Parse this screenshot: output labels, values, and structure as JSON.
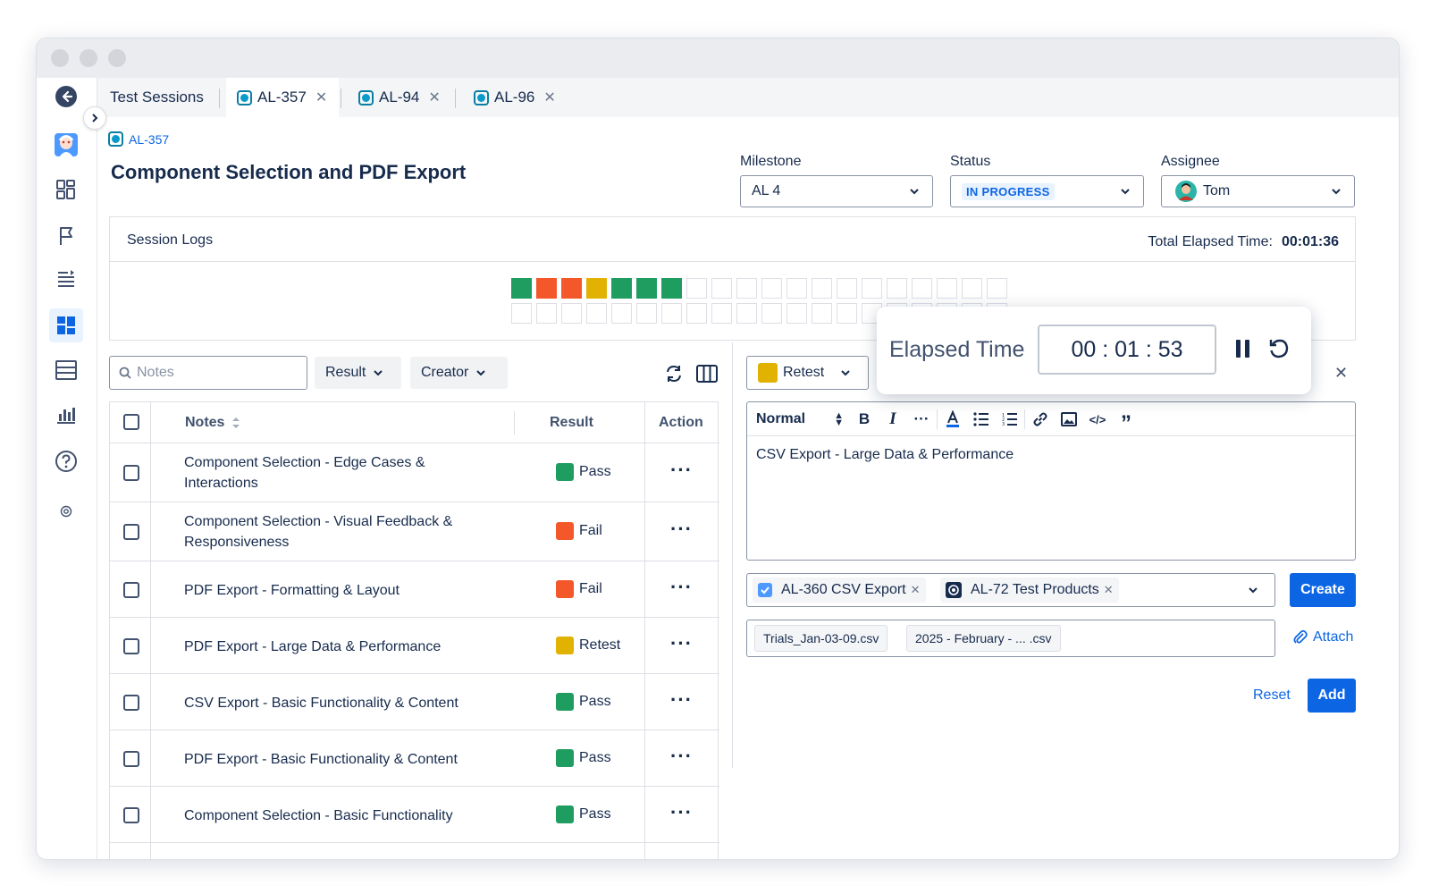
{
  "tabs": {
    "home_label": "Test Sessions",
    "items": [
      {
        "label": "AL-357"
      },
      {
        "label": "AL-94"
      },
      {
        "label": "AL-96"
      }
    ]
  },
  "header": {
    "issue_key": "AL-357",
    "title": "Component Selection and PDF Export"
  },
  "fields": {
    "milestone": {
      "label": "Milestone",
      "value": "AL 4"
    },
    "status": {
      "label": "Status",
      "value": "IN PROGRESS"
    },
    "assignee": {
      "label": "Assignee",
      "value": "Tom"
    }
  },
  "session_logs": {
    "title": "Session Logs",
    "elapsed_label": "Total Elapsed Time:",
    "elapsed_value": "00:01:36",
    "result_colors": [
      "#1f9d61",
      "#f4572a",
      "#f4572a",
      "#e2b203",
      "#1f9d61",
      "#1f9d61",
      "#1f9d61"
    ]
  },
  "toolbar": {
    "search_placeholder": "Notes",
    "result_filter": "Result",
    "creator_filter": "Creator"
  },
  "table": {
    "columns": {
      "notes": "Notes",
      "result": "Result",
      "action": "Action"
    },
    "rows": [
      {
        "note_line1": "Component Selection - Edge Cases &",
        "note_line2": "Interactions",
        "result": "Pass",
        "color": "#1f9d61"
      },
      {
        "note_line1": "Component Selection - Visual Feedback &",
        "note_line2": "Responsiveness",
        "result": "Fail",
        "color": "#f4572a"
      },
      {
        "note_line1": "PDF Export - Formatting & Layout",
        "note_line2": "",
        "result": "Fail",
        "color": "#f4572a"
      },
      {
        "note_line1": "PDF Export - Large Data & Performance",
        "note_line2": "",
        "result": "Retest",
        "color": "#e2b203"
      },
      {
        "note_line1": "CSV Export - Basic Functionality & Content",
        "note_line2": "",
        "result": "Pass",
        "color": "#1f9d61"
      },
      {
        "note_line1": "PDF Export - Basic Functionality & Content",
        "note_line2": "",
        "result": "Pass",
        "color": "#1f9d61"
      },
      {
        "note_line1": "Component Selection - Basic Functionality",
        "note_line2": "",
        "result": "Pass",
        "color": "#1f9d61"
      }
    ]
  },
  "editor": {
    "result_value": "Retest",
    "result_color": "#e2b203",
    "text_style": "Normal",
    "content": "CSV Export - Large Data & Performance",
    "linked_issues": [
      {
        "label": "AL-360 CSV Export"
      },
      {
        "label": "AL-72 Test Products"
      }
    ],
    "create_label": "Create",
    "attachments": [
      "Trials_Jan-03-09.csv",
      "2025 - February - ... .csv"
    ],
    "attach_label": "Attach",
    "reset_label": "Reset",
    "add_label": "Add"
  },
  "timer": {
    "label": "Elapsed Time",
    "value": "00 : 01 : 53"
  }
}
